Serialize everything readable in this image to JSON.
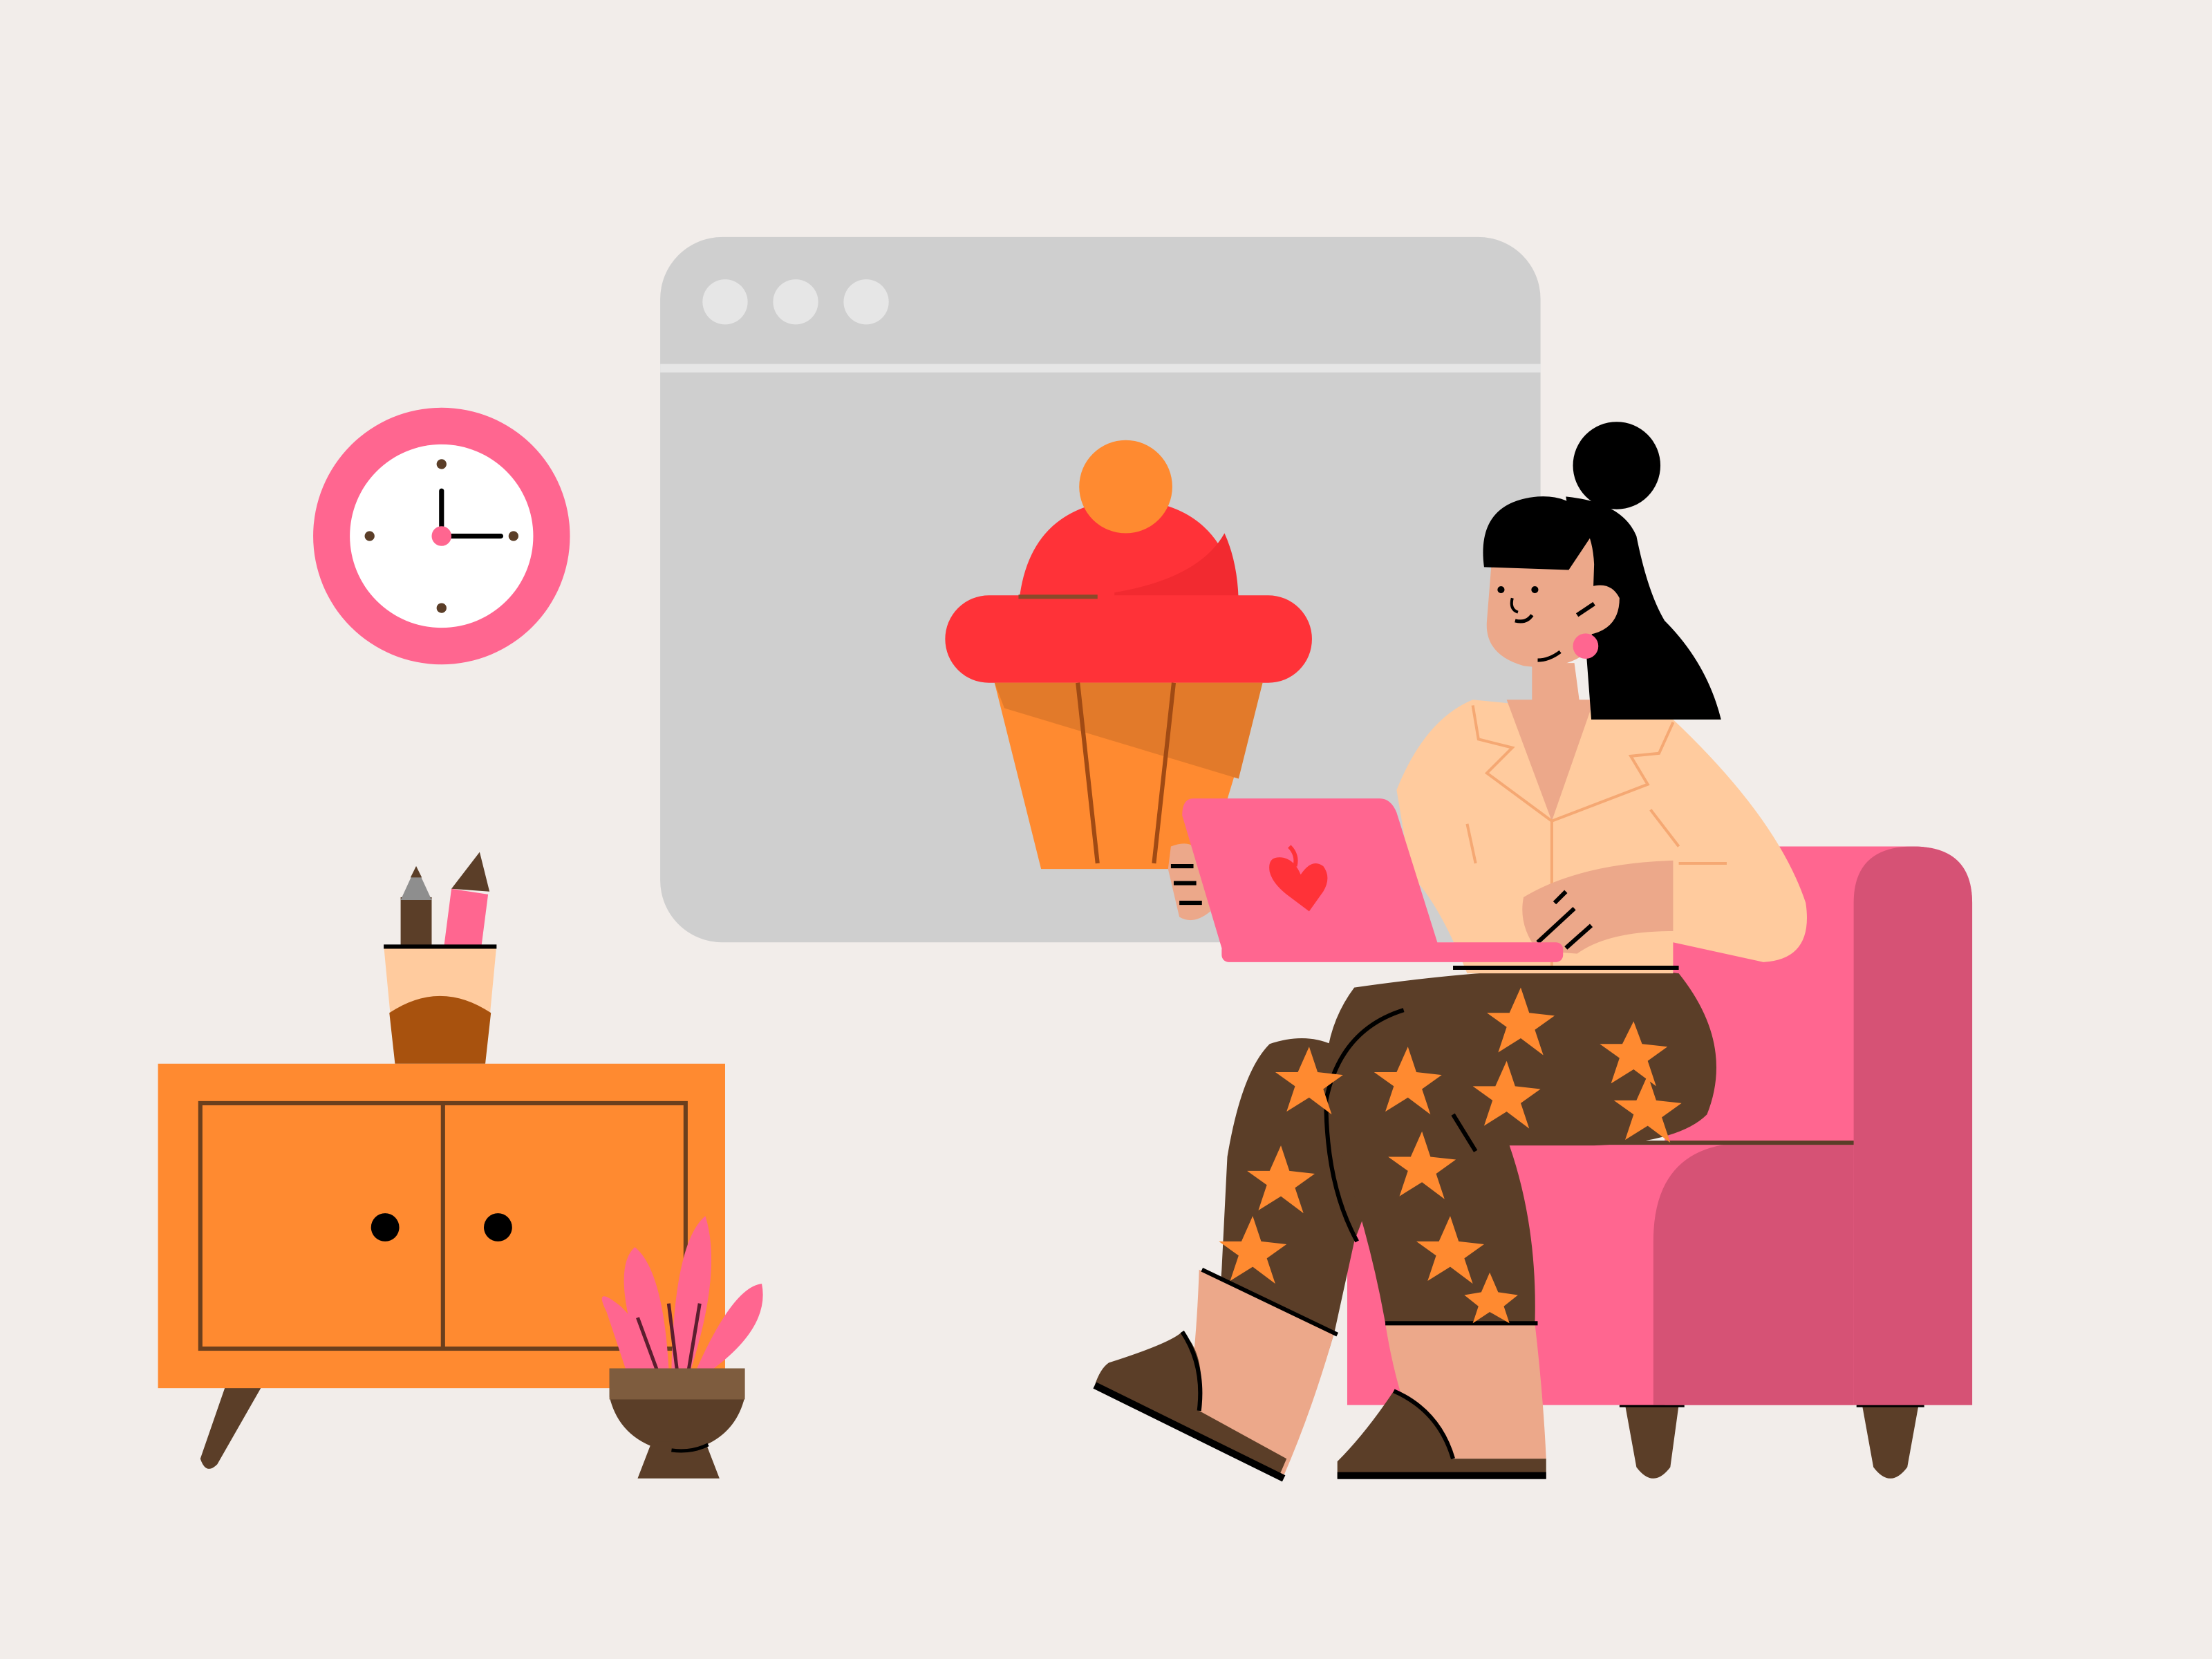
{
  "scene": {
    "background": "#F2EDEA",
    "description_colors": {
      "browser_gray": "#CFCFCF",
      "browser_dots": "#E6E6E6",
      "clock_pink": "#FF6690",
      "cabinet_orange": "#FF8A30",
      "cabinet_line": "#6B3F1D",
      "armchair_pink": "#FF6690",
      "armchair_shadow": "#D65275",
      "cupcake_red": "#FF3238",
      "cupcake_orange": "#FF8A30",
      "skin": "#ECA88A",
      "shirt": "#FFCB9E",
      "pants_brown": "#5B3E28",
      "hair_black": "#000000",
      "laptop_pink": "#FF6690"
    }
  },
  "browser_window": {
    "dots": [
      "dot-1",
      "dot-2",
      "dot-3"
    ]
  },
  "clock": {
    "time_shown": "3:00"
  },
  "icons": {
    "laptop_logo": "heart-icon",
    "clock": "clock-icon",
    "cupcake": "cupcake-icon"
  }
}
